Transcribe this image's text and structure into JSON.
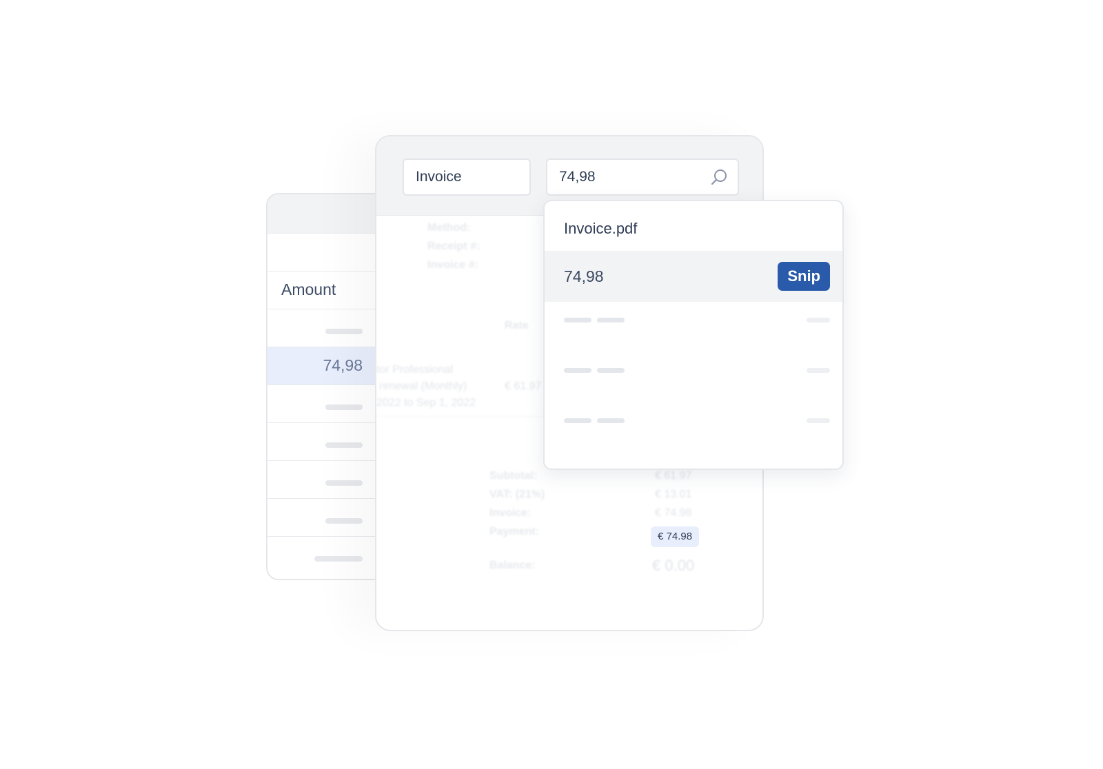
{
  "table": {
    "column_label": "Amount",
    "highlighted_value": "74,98"
  },
  "search": {
    "type_value": "Invoice",
    "amount_value": "74,98"
  },
  "document": {
    "meta_labels": [
      "Method:",
      "Receipt #:",
      "Invoice #:"
    ],
    "rate_label": "Rate",
    "item_lines": [
      "tor Professional",
      "renewal (Monthly)",
      "2022 to Sep 1, 2022"
    ],
    "item_amount": "€ 61.97",
    "totals": [
      {
        "label": "Subtotal:",
        "value": "€ 61.97"
      },
      {
        "label": "VAT: (21%)",
        "value": "€ 13.01"
      },
      {
        "label": "Invoice:",
        "value": "€ 74.98"
      },
      {
        "label": "Payment:",
        "value": "€ 74.98"
      }
    ],
    "balance_label": "Balance:",
    "balance_value": "€ 0.00"
  },
  "results": {
    "file_name": "Invoice.pdf",
    "match_value": "74,98",
    "action_label": "Snip"
  },
  "colors": {
    "accent": "#2a5bab",
    "highlight": "#e8eefb"
  }
}
